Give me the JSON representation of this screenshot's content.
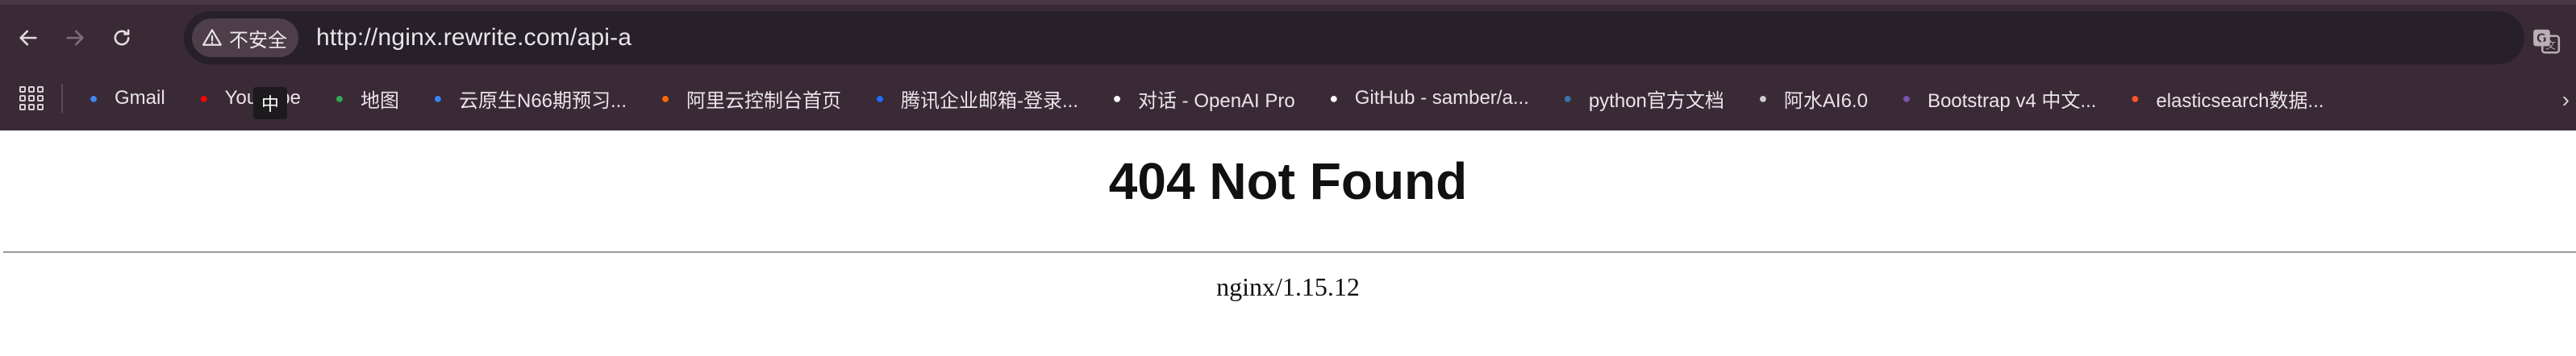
{
  "browser": {
    "url": "http://nginx.rewrite.com/api-a",
    "security_label": "不安全",
    "ime_label": "中",
    "bookmarks": [
      {
        "label": "Gmail",
        "icon": "gmail-icon",
        "color": "#4285f4"
      },
      {
        "label": "YouTube",
        "icon": "youtube-icon",
        "color": "#ff0000"
      },
      {
        "label": "地图",
        "icon": "maps-icon",
        "color": "#34a853"
      },
      {
        "label": "云原生N66期预习...",
        "icon": "cloud-icon",
        "color": "#3b82f6"
      },
      {
        "label": "阿里云控制台首页",
        "icon": "aliyun-icon",
        "color": "#ff6a00"
      },
      {
        "label": "腾讯企业邮箱-登录...",
        "icon": "tencent-mail-icon",
        "color": "#1e6fff"
      },
      {
        "label": "对话 - OpenAI Pro",
        "icon": "openai-icon",
        "color": "#ffffff"
      },
      {
        "label": "GitHub - samber/a...",
        "icon": "github-icon",
        "color": "#ffffff"
      },
      {
        "label": "python官方文档",
        "icon": "python-icon",
        "color": "#3776ab"
      },
      {
        "label": "阿水AI6.0",
        "icon": "ai-icon",
        "color": "#cccccc"
      },
      {
        "label": "Bootstrap v4 中文...",
        "icon": "bootstrap-icon",
        "color": "#7952b3"
      },
      {
        "label": "elasticsearch数据...",
        "icon": "csdn-icon",
        "color": "#fc5531"
      }
    ]
  },
  "page": {
    "title": "404 Not Found",
    "server": "nginx/1.15.12"
  }
}
